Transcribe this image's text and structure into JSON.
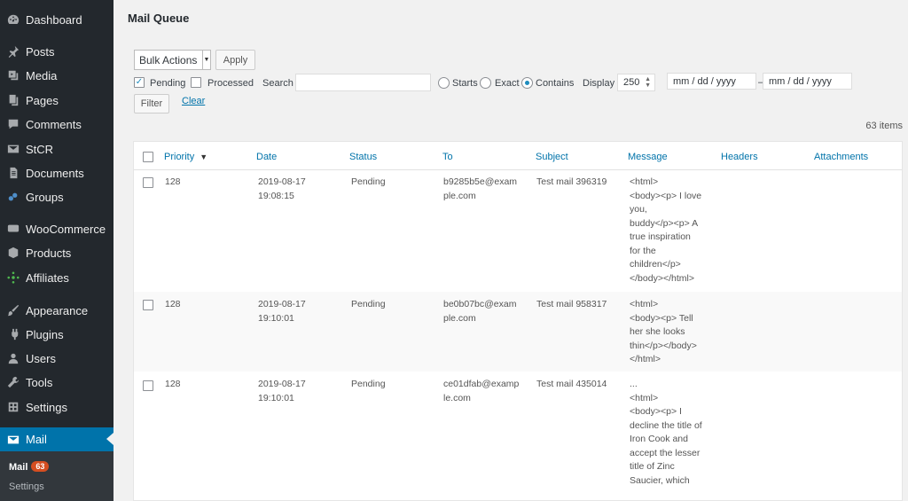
{
  "sidebar": {
    "items": [
      {
        "label": "Dashboard",
        "icon": "dashboard-icon"
      },
      {
        "label": "Posts",
        "icon": "pin-icon"
      },
      {
        "label": "Media",
        "icon": "media-icon"
      },
      {
        "label": "Pages",
        "icon": "pages-icon"
      },
      {
        "label": "Comments",
        "icon": "comments-icon"
      },
      {
        "label": "StCR",
        "icon": "envelope-icon"
      },
      {
        "label": "Documents",
        "icon": "document-icon"
      },
      {
        "label": "Groups",
        "icon": "groups-icon"
      },
      {
        "label": "WooCommerce",
        "icon": "woocommerce-icon"
      },
      {
        "label": "Products",
        "icon": "products-icon"
      },
      {
        "label": "Affiliates",
        "icon": "affiliates-icon"
      },
      {
        "label": "Appearance",
        "icon": "brush-icon"
      },
      {
        "label": "Plugins",
        "icon": "plugin-icon"
      },
      {
        "label": "Users",
        "icon": "user-icon"
      },
      {
        "label": "Tools",
        "icon": "wrench-icon"
      },
      {
        "label": "Settings",
        "icon": "settings-icon"
      },
      {
        "label": "Mail",
        "icon": "envelope-icon"
      }
    ],
    "submenu": {
      "mail": "Mail",
      "mail_count": "63",
      "settings": "Settings"
    }
  },
  "page": {
    "title": "Mail Queue"
  },
  "toolbar": {
    "bulk_actions": "Bulk Actions",
    "apply": "Apply",
    "pending": "Pending",
    "processed": "Processed",
    "search": "Search",
    "search_value": "",
    "starts": "Starts",
    "exact": "Exact",
    "contains": "Contains",
    "display": "Display",
    "display_value": "250",
    "date_from": "mm / dd / yyyy",
    "date_sep": "–",
    "date_to": "mm / dd / yyyy",
    "filter": "Filter",
    "clear": "Clear"
  },
  "items_count": "63 items",
  "table": {
    "columns": {
      "priority": "Priority",
      "date": "Date",
      "status": "Status",
      "to": "To",
      "subject": "Subject",
      "message": "Message",
      "headers": "Headers",
      "attachments": "Attachments"
    },
    "rows": [
      {
        "priority": "128",
        "date": "2019-08-17\n19:08:15",
        "status": "Pending",
        "to": "b9285b5e@exam\nple.com",
        "subject": "Test mail 396319",
        "message": "<html>\n<body><p> I love\nyou,\nbuddy</p><p> A\ntrue inspiration\nfor the\nchildren</p>\n</body></html>"
      },
      {
        "priority": "128",
        "date": "2019-08-17\n19:10:01",
        "status": "Pending",
        "to": "be0b07bc@exam\nple.com",
        "subject": "Test mail 958317",
        "message": "<html>\n<body><p> Tell\nher she looks\nthin</p></body>\n</html>"
      },
      {
        "priority": "128",
        "date": "2019-08-17\n19:10:01",
        "status": "Pending",
        "to": "ce01dfab@examp\nle.com",
        "subject": "Test mail 435014",
        "message": "...\n<html>\n<body><p> I\ndecline the title of\nIron Cook and\naccept the lesser\ntitle of Zinc\nSaucier, which"
      }
    ]
  }
}
